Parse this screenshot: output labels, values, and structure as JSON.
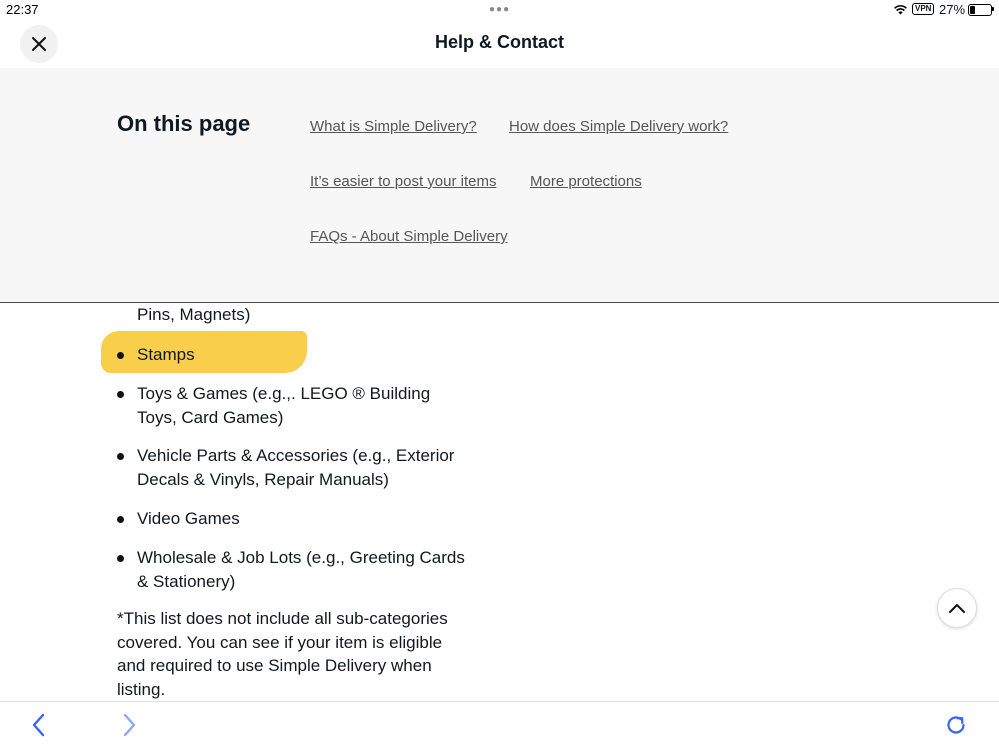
{
  "status_bar": {
    "time": "22:37",
    "vpn": "VPN",
    "battery": "27%",
    "battery_level": 0.27,
    "icons": [
      "wifi-icon",
      "battery-icon"
    ]
  },
  "header": {
    "title": "Help & Contact",
    "close_icon": "close-icon"
  },
  "on_this_page": {
    "heading": "On this page",
    "links": [
      "What is Simple Delivery?",
      "How does Simple Delivery work?",
      "It’s easier to post your items",
      "More protections",
      "FAQs - About Simple Delivery"
    ]
  },
  "content": {
    "continuation": "Pins, Magnets)",
    "items": [
      "Stamps",
      "Toys & Games (e.g.,. LEGO ® Building Toys, Card Games)",
      "Vehicle Parts & Accessories (e.g., Exterior Decals & Vinyls, Repair Manuals)",
      "Video Games",
      "Wholesale & Job Lots (e.g., Greeting Cards & Stationery)"
    ],
    "highlighted_item": "Stamps",
    "highlight_color": "#f7c936",
    "footnote": "*This list does not include all sub-categories covered. You can see if your item is eligible and required to use Simple Delivery when listing."
  },
  "controls": {
    "scroll_top_icon": "chevron-up-icon",
    "back_icon": "back-arrow-icon",
    "forward_icon": "forward-arrow-icon",
    "reload_icon": "reload-icon",
    "accent_color": "#3665f3"
  }
}
